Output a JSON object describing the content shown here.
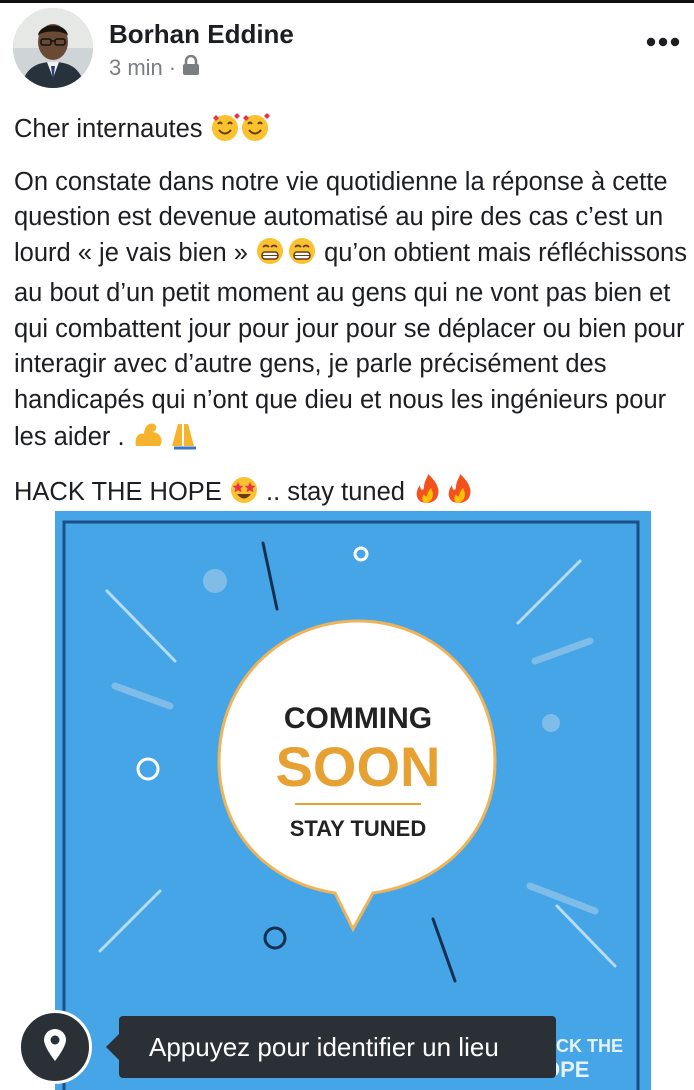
{
  "post": {
    "author": "Borhan Eddine",
    "time": "3 min",
    "separator": "·",
    "privacy_icon": "lock-icon",
    "more_icon": "more-options-icon"
  },
  "content": {
    "greeting": "Cher internautes",
    "greeting_emojis": [
      "smiling-face-with-hearts",
      "smiling-face-with-hearts"
    ],
    "para_part1": "On constate dans notre vie quotidienne la réponse à cette question est devenue automatisé au pire des cas c’est un lourd « je vais bien »",
    "para_emojis1": [
      "beaming-face",
      "beaming-face"
    ],
    "para_part2": "qu’on obtient mais réfléchissons au bout d’un petit moment au gens qui ne vont pas bien et qui combattent jour pour jour pour se déplacer ou bien pour interagir avec d’autre gens, je parle précisément des handicapés qui n’ont que dieu et nous les ingénieurs pour les aider .",
    "para_emojis2": [
      "flexed-biceps",
      "folded-hands"
    ],
    "closing": "HACK THE HOPE",
    "closing_emoji": "star-struck",
    "closing_end": ".. stay tuned",
    "closing_emojis2": [
      "fire",
      "fire"
    ]
  },
  "image": {
    "line1": "COMMING",
    "line2": "SOON",
    "line3": "STAY TUNED",
    "logo_text_a": "ACK THE",
    "logo_text_b": "OPE",
    "colors": {
      "background": "#45a5e7",
      "frame": "#1d4f86",
      "soon": "#e7a132",
      "text": "#222222"
    }
  },
  "location": {
    "tooltip": "Appuyez pour identifier un lieu",
    "button_icon": "location-pin-icon"
  }
}
